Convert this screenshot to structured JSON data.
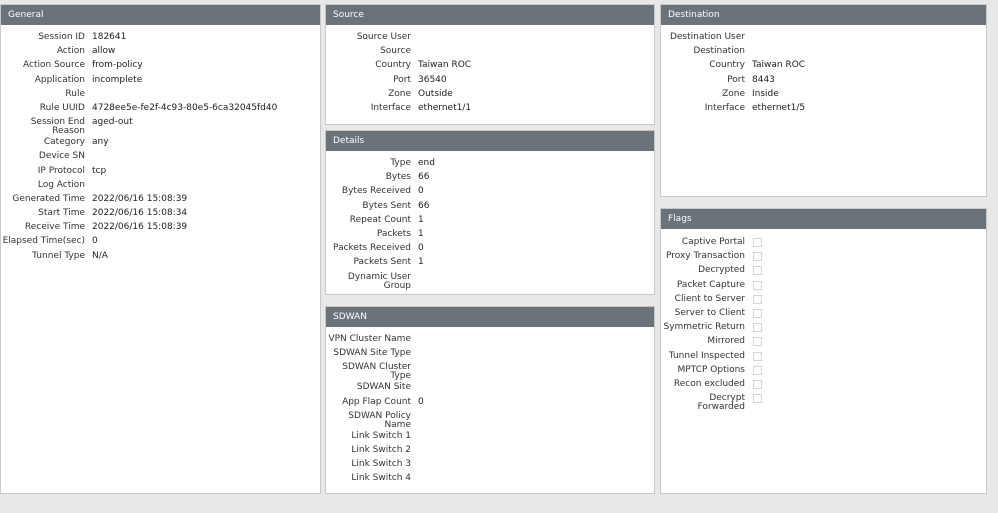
{
  "general": {
    "title": "General",
    "rows": [
      {
        "label": "Session ID",
        "value": "182641"
      },
      {
        "label": "Action",
        "value": "allow"
      },
      {
        "label": "Action Source",
        "value": "from-policy"
      },
      {
        "label": "Application",
        "value": "incomplete"
      },
      {
        "label": "Rule",
        "value": ""
      },
      {
        "label": "Rule UUID",
        "value": "4728ee5e-fe2f-4c93-80e5-6ca32045fd40"
      },
      {
        "label": "Session End Reason",
        "value": "aged-out"
      },
      {
        "label": "Category",
        "value": "any"
      },
      {
        "label": "Device SN",
        "value": ""
      },
      {
        "label": "IP Protocol",
        "value": "tcp"
      },
      {
        "label": "Log Action",
        "value": ""
      },
      {
        "label": "Generated Time",
        "value": "2022/06/16 15:08:39"
      },
      {
        "label": "Start Time",
        "value": "2022/06/16 15:08:34"
      },
      {
        "label": "Receive Time",
        "value": "2022/06/16 15:08:39"
      },
      {
        "label": "Elapsed Time(sec)",
        "value": "0"
      },
      {
        "label": "Tunnel Type",
        "value": "N/A"
      }
    ]
  },
  "source": {
    "title": "Source",
    "rows": [
      {
        "label": "Source User",
        "value": ""
      },
      {
        "label": "Source",
        "value": ""
      },
      {
        "label": "Country",
        "value": "Taiwan ROC"
      },
      {
        "label": "Port",
        "value": "36540"
      },
      {
        "label": "Zone",
        "value": "Outside"
      },
      {
        "label": "Interface",
        "value": "ethernet1/1"
      }
    ]
  },
  "details": {
    "title": "Details",
    "rows": [
      {
        "label": "Type",
        "value": "end"
      },
      {
        "label": "Bytes",
        "value": "66"
      },
      {
        "label": "Bytes Received",
        "value": "0"
      },
      {
        "label": "Bytes Sent",
        "value": "66"
      },
      {
        "label": "Repeat Count",
        "value": "1"
      },
      {
        "label": "Packets",
        "value": "1"
      },
      {
        "label": "Packets Received",
        "value": "0"
      },
      {
        "label": "Packets Sent",
        "value": "1"
      },
      {
        "label": "Dynamic User Group",
        "value": ""
      }
    ]
  },
  "sdwan": {
    "title": "SDWAN",
    "rows": [
      {
        "label": "VPN Cluster Name",
        "value": ""
      },
      {
        "label": "SDWAN Site Type",
        "value": ""
      },
      {
        "label": "SDWAN Cluster Type",
        "value": ""
      },
      {
        "label": "SDWAN Site",
        "value": ""
      },
      {
        "label": "App Flap Count",
        "value": "0"
      },
      {
        "label": "SDWAN Policy Name",
        "value": ""
      },
      {
        "label": "Link Switch 1",
        "value": ""
      },
      {
        "label": "Link Switch 2",
        "value": ""
      },
      {
        "label": "Link Switch 3",
        "value": ""
      },
      {
        "label": "Link Switch 4",
        "value": ""
      }
    ]
  },
  "destination": {
    "title": "Destination",
    "rows": [
      {
        "label": "Destination User",
        "value": ""
      },
      {
        "label": "Destination",
        "value": ""
      },
      {
        "label": "Country",
        "value": "Taiwan ROC"
      },
      {
        "label": "Port",
        "value": "8443"
      },
      {
        "label": "Zone",
        "value": "Inside"
      },
      {
        "label": "Interface",
        "value": "ethernet1/5"
      }
    ]
  },
  "flags": {
    "title": "Flags",
    "items": [
      {
        "label": "Captive Portal",
        "checked": false
      },
      {
        "label": "Proxy Transaction",
        "checked": false
      },
      {
        "label": "Decrypted",
        "checked": false
      },
      {
        "label": "Packet Capture",
        "checked": false
      },
      {
        "label": "Client to Server",
        "checked": false
      },
      {
        "label": "Server to Client",
        "checked": false
      },
      {
        "label": "Symmetric Return",
        "checked": false
      },
      {
        "label": "Mirrored",
        "checked": false
      },
      {
        "label": "Tunnel Inspected",
        "checked": false
      },
      {
        "label": "MPTCP Options",
        "checked": false
      },
      {
        "label": "Recon excluded",
        "checked": false
      },
      {
        "label": "Decrypt Forwarded",
        "checked": false
      }
    ]
  }
}
